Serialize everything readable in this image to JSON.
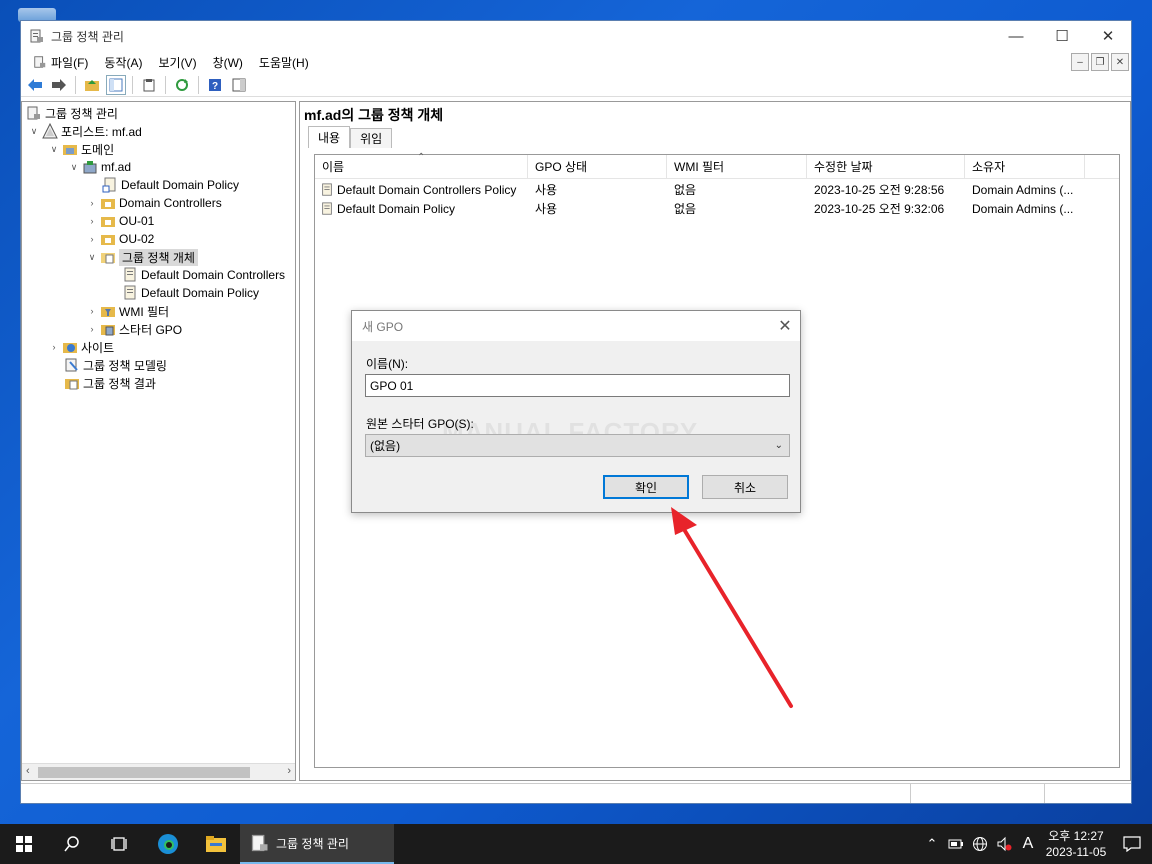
{
  "window": {
    "title": "그룹 정책 관리"
  },
  "menu": [
    "파일(F)",
    "동작(A)",
    "보기(V)",
    "창(W)",
    "도움말(H)"
  ],
  "tree": {
    "root": "그룹 정책 관리",
    "forest": "포리스트: mf.ad",
    "domains": "도메인",
    "domain": "mf.ad",
    "ddp": "Default Domain Policy",
    "dc": "Domain Controllers",
    "ou1": "OU-01",
    "ou2": "OU-02",
    "gpo": "그룹 정책 개체",
    "gpo_ddcp": "Default Domain Controllers",
    "gpo_ddp": "Default Domain Policy",
    "wmi": "WMI 필터",
    "starter": "스타터 GPO",
    "sites": "사이트",
    "modeling": "그룹 정책 모델링",
    "results": "그룹 정책 결과"
  },
  "content": {
    "title": "mf.ad의 그룹 정책 개체",
    "tabs": [
      "내용",
      "위임"
    ],
    "columns": [
      "이름",
      "GPO 상태",
      "WMI 필터",
      "수정한 날짜",
      "소유자"
    ],
    "rows": [
      [
        "Default Domain Controllers Policy",
        "사용",
        "없음",
        "2023-10-25 오전 9:28:56",
        "Domain Admins (..."
      ],
      [
        "Default Domain Policy",
        "사용",
        "없음",
        "2023-10-25 오전 9:32:06",
        "Domain Admins (..."
      ]
    ]
  },
  "dialog": {
    "title": "새 GPO",
    "name_label": "이름(N):",
    "name_value": "GPO 01",
    "source_label": "원본 스타터 GPO(S):",
    "source_value": "(없음)",
    "ok": "확인",
    "cancel": "취소",
    "watermark": "MANUAL FACTORY"
  },
  "taskbar": {
    "app": "그룹 정책 관리",
    "ime": "A",
    "time": "오후 12:27",
    "date": "2023-11-05"
  },
  "colors": {
    "annotation_arrow": "#e8232a",
    "accent": "#0078d7"
  }
}
